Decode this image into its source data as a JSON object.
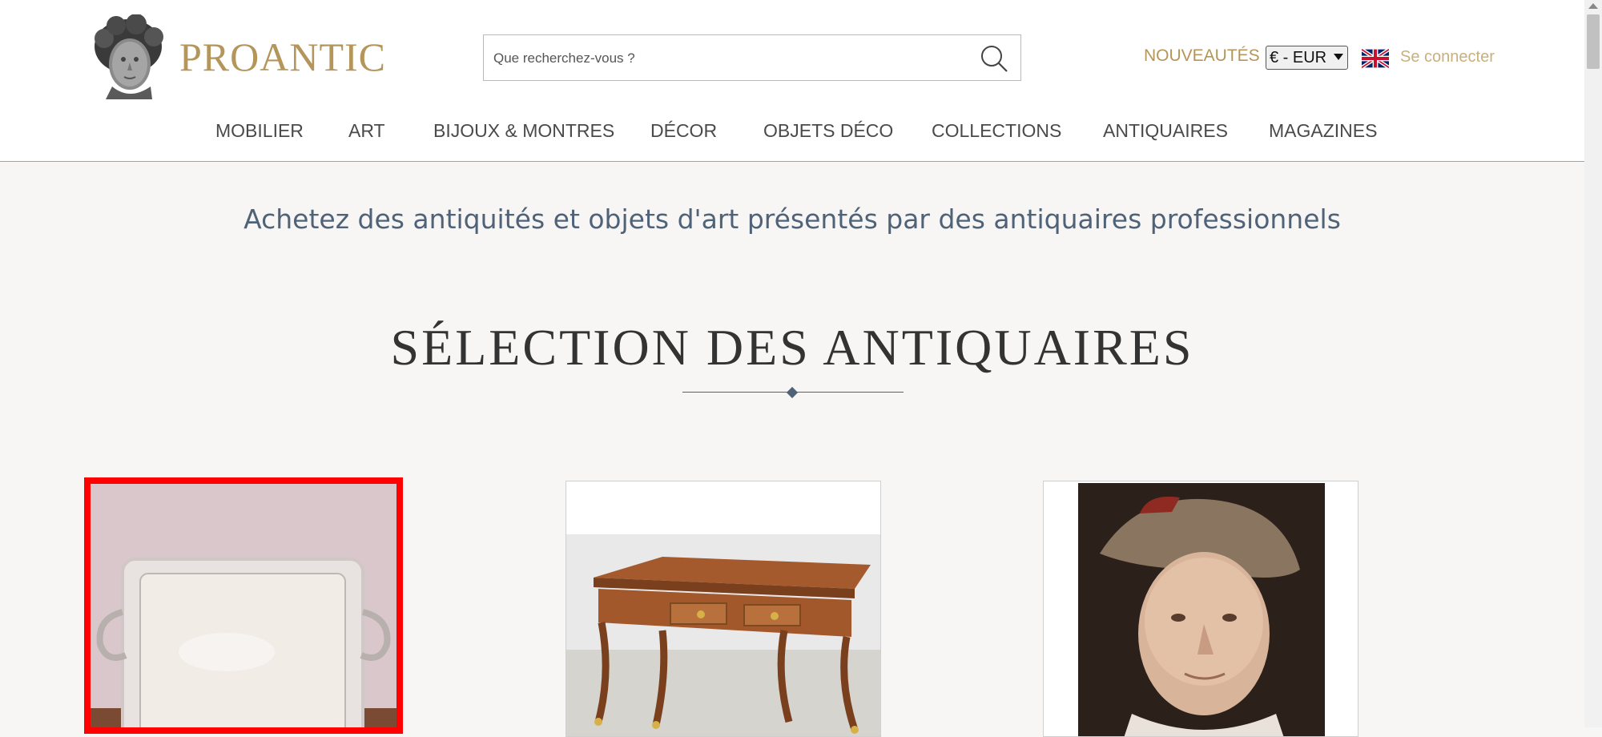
{
  "header": {
    "logo_text": "PROANTIC",
    "search": {
      "placeholder": "Que recherchez-vous ?"
    },
    "nouveautes": "NOUVEAUTÉS",
    "currency": "€ - EUR",
    "connect": "Se connecter"
  },
  "nav": [
    "MOBILIER",
    "ART",
    "BIJOUX & MONTRES",
    "DÉCOR",
    "OBJETS DÉCO",
    "COLLECTIONS",
    "ANTIQUAIRES",
    "MAGAZINES"
  ],
  "tagline": "Achetez des antiquités et objets d'art présentés par des antiquaires professionnels",
  "section_title": "SÉLECTION DES ANTIQUAIRES",
  "colors": {
    "accent_gold": "#b4955a",
    "slate_blue": "#4f6278",
    "selection_red": "#ff0000"
  }
}
